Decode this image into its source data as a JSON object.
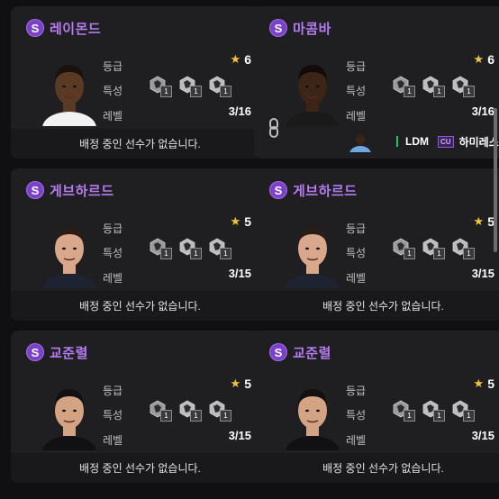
{
  "labels": {
    "grade": "등급",
    "trait": "특성",
    "level": "레벨"
  },
  "cards": [
    {
      "name": "레이몬드",
      "grade": "6",
      "level": "3/16",
      "footer": "배정 중인 선수가 없습니다.",
      "skin": "#5a3a24",
      "hair": "#1b1210",
      "shirt": "#f2f2f2",
      "trait_levels": [
        "1",
        "1",
        "1"
      ]
    },
    {
      "name": "마콤바",
      "grade": "6",
      "level": "3/16",
      "footer": "",
      "skin": "#3c2416",
      "hair": "#120b08",
      "shirt": "#1a1a1a",
      "trait_levels": [
        "1",
        "1",
        "1"
      ],
      "assigned": {
        "position": "LDM",
        "class": "CU",
        "player": "하미레스"
      }
    },
    {
      "name": "게브하르드",
      "grade": "5",
      "level": "3/15",
      "footer": "배정 중인 선수가 없습니다.",
      "skin": "#d9a88c",
      "hair": "#2a1d17",
      "shirt": "#1d2330",
      "trait_levels": [
        "1",
        "1",
        "1"
      ]
    },
    {
      "name": "게브하르드",
      "grade": "5",
      "level": "3/15",
      "footer": "배정 중인 선수가 없습니다.",
      "skin": "#d9a88c",
      "hair": "#2a1d17",
      "shirt": "#1d2330",
      "trait_levels": [
        "1",
        "1",
        "1"
      ]
    },
    {
      "name": "교준렬",
      "grade": "5",
      "level": "3/15",
      "footer": "배정 중인 선수가 없습니다.",
      "skin": "#d3a383",
      "hair": "#141012",
      "shirt": "#111114",
      "trait_levels": [
        "1",
        "1",
        "1"
      ]
    },
    {
      "name": "교준렬",
      "grade": "5",
      "level": "3/15",
      "footer": "배정 중인 선수가 없습니다.",
      "skin": "#d3a383",
      "hair": "#141012",
      "shirt": "#111114",
      "trait_levels": [
        "1",
        "1",
        "1"
      ]
    }
  ],
  "colors": {
    "accent": "#b57cf0",
    "star": "#f2c33c",
    "card_bg": "#1f1f22"
  }
}
